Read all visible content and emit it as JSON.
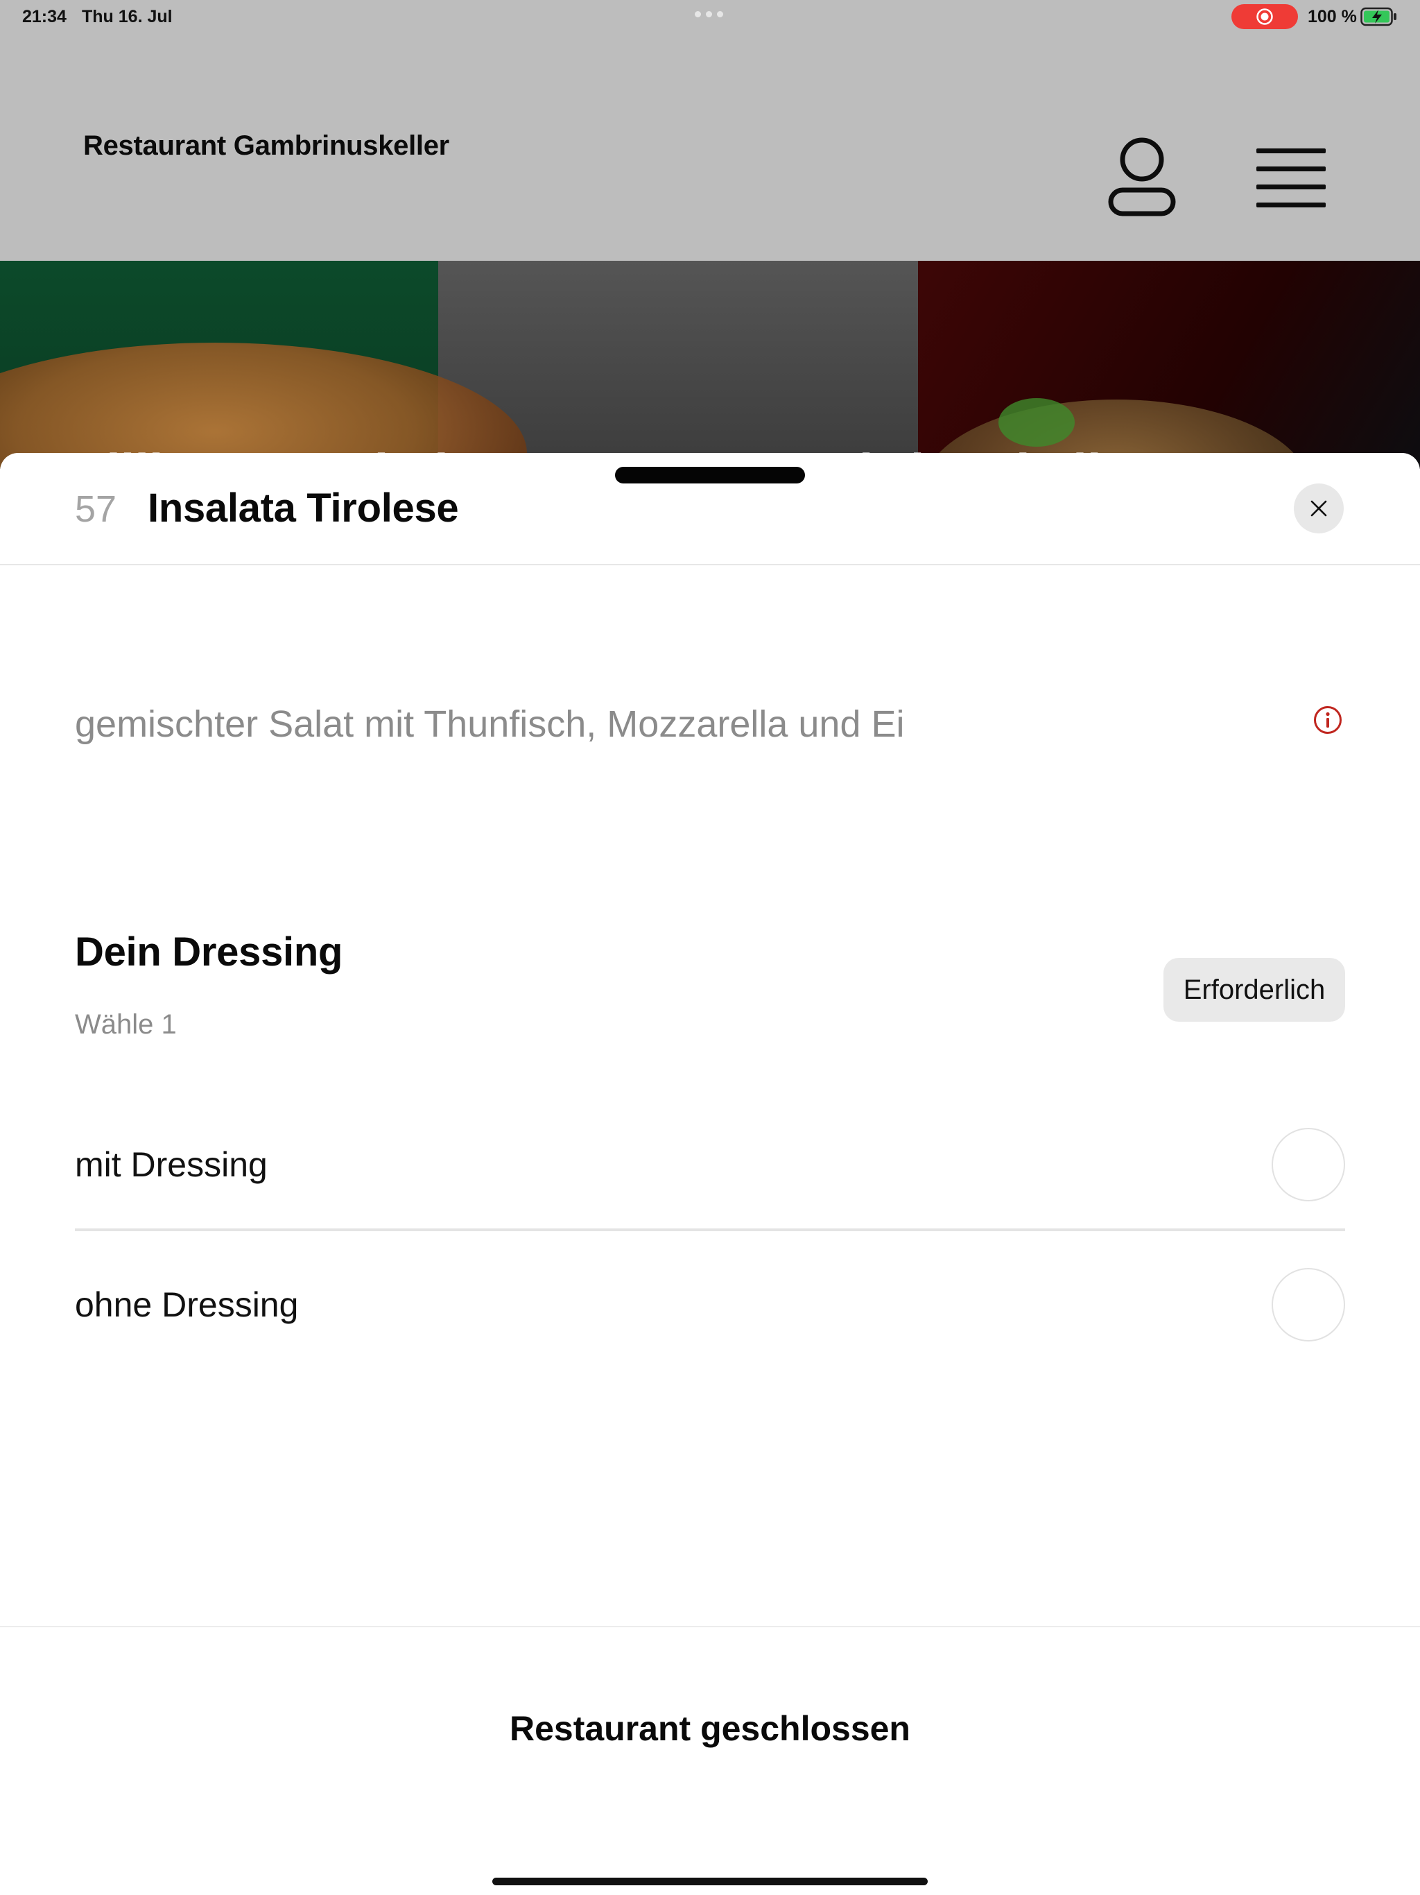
{
  "status_bar": {
    "time": "21:34",
    "date": "Thu 16. Jul",
    "battery": "100 %",
    "record_color": "#ef3b36",
    "battery_color": "#34c759"
  },
  "header": {
    "brand": "Restaurant Gambrinuskeller",
    "account_icon": "person-icon",
    "menu_icon": "hamburger-menu-icon"
  },
  "hero": {
    "title": "Willkommen bei Restaurant Gambrinuskeller"
  },
  "item": {
    "number": "57",
    "title": "Insalata Tirolese",
    "description": "gemischter Salat mit Thunfisch, Mozzarella und Ei",
    "info_icon": "info-icon",
    "accent_color": "#c0261f"
  },
  "option_group": {
    "title": "Dein Dressing",
    "subtitle": "Wähle 1",
    "badge": "Erforderlich",
    "options": [
      {
        "label": "mit Dressing",
        "selected": false
      },
      {
        "label": "ohne Dressing",
        "selected": false
      }
    ]
  },
  "footer": {
    "status": "Restaurant geschlossen"
  }
}
